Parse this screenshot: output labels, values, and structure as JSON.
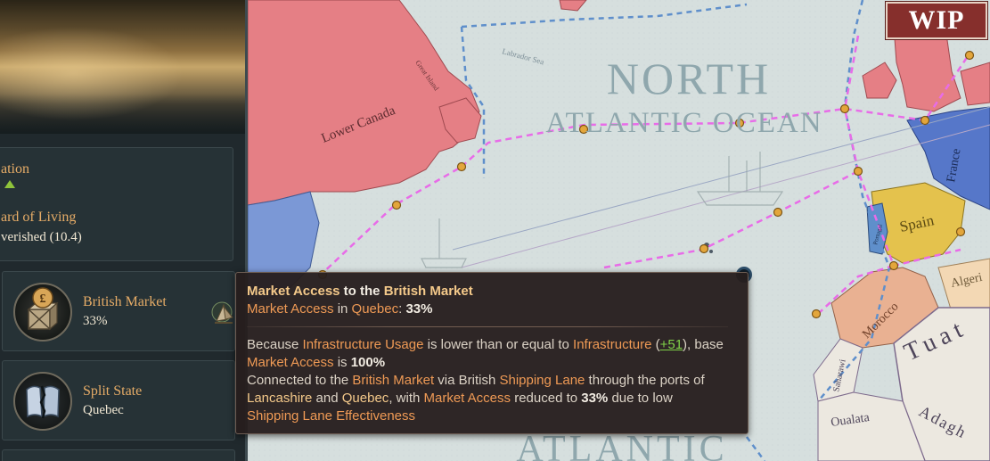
{
  "left_panel": {
    "info_fragments": {
      "line1": "ation",
      "line2": "ard of Living",
      "line3": "verished (10.4)"
    },
    "market": {
      "name": "British Market",
      "percent": "33%"
    },
    "split": {
      "name": "Split State",
      "state": "Quebec"
    }
  },
  "map": {
    "labels": {
      "north": "NORTH",
      "atlantic_ocean": "ATLANTIC OCEAN",
      "atlantic_bottom": "ATLANTIC",
      "lower_canada": "Lower Canada",
      "labrador_sea": "Labrador Sea",
      "great_island": "Great Island",
      "spain": "Spain",
      "portugal": "Portugal",
      "france": "France",
      "morocco": "Morocco",
      "tuat": "Tuat",
      "saharawi": "Saharawi",
      "oualata": "Oualata",
      "adagh": "Adagh",
      "algeria": "Algeri"
    },
    "colors": {
      "ocean": "#d6dfde",
      "britain_red": "#e57f85",
      "france_blue": "#5677c9",
      "spain_yellow": "#e4c24d",
      "morocco_peach": "#e9b192",
      "desert": "#ece8e0",
      "shipping_lane_pink": "#e86ce8",
      "route_blue": "#5f8fcb",
      "port_gold": "#e3a63b"
    }
  },
  "wip_badge": {
    "label": "WIP"
  },
  "tooltip": {
    "title": {
      "a": "Market Access",
      "b": " to the ",
      "c": "British Market"
    },
    "subtitle": {
      "a": "Market Access",
      "b": " in ",
      "c": "Quebec",
      "d": ": ",
      "e": "33%"
    },
    "body1": {
      "a": "Because ",
      "b": "Infrastructure Usage",
      "c": " is lower than or equal to ",
      "d": "Infrastructure",
      "e": " (",
      "f": "+51",
      "g": "), base"
    },
    "body2": {
      "a": "Market Access",
      "b": " is ",
      "c": "100%"
    },
    "body3": {
      "a": "Connected to the ",
      "b": "British Market",
      "c": " via British ",
      "d": "Shipping Lane",
      "e": " through the ports of"
    },
    "body4": {
      "a": "Lancashire",
      "b": " and ",
      "c": "Quebec",
      "d": ", with ",
      "e": "Market Access",
      "f": " reduced to ",
      "g": "33%",
      "h": " due to low"
    },
    "body5": {
      "a": "Shipping Lane Effectiveness"
    }
  }
}
